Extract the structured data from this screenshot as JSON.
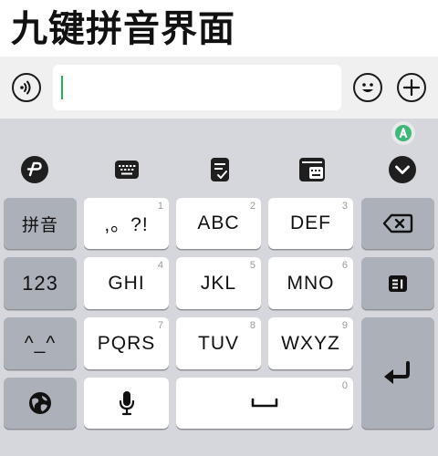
{
  "header": {
    "title": "九键拼音界面"
  },
  "input_bar": {
    "text": ""
  },
  "keys": {
    "pinyin": "拼音",
    "num_mode": "123",
    "emoticon": "^_^",
    "k1": {
      "label": ",。?!",
      "digit": "1"
    },
    "k2": {
      "label": "ABC",
      "digit": "2"
    },
    "k3": {
      "label": "DEF",
      "digit": "3"
    },
    "k4": {
      "label": "GHI",
      "digit": "4"
    },
    "k5": {
      "label": "JKL",
      "digit": "5"
    },
    "k6": {
      "label": "MNO",
      "digit": "6"
    },
    "k7": {
      "label": "PQRS",
      "digit": "7"
    },
    "k8": {
      "label": "TUV",
      "digit": "8"
    },
    "k9": {
      "label": "WXYZ",
      "digit": "9"
    },
    "k0": {
      "digit": "0"
    }
  },
  "icons": {
    "voice": "sound-wave-icon",
    "emoji": "smiley-icon",
    "add": "plus-icon",
    "badge": "assistant-badge-icon",
    "toolbar": [
      "swipe-logo-icon",
      "keyboard-icon",
      "clipboard-icon",
      "keyboard-switch-icon",
      "collapse-icon"
    ],
    "delete": "backspace-icon",
    "edit": "edit-panel-icon",
    "globe": "globe-icon",
    "mic": "microphone-icon",
    "space": "space-icon",
    "enter": "enter-icon"
  },
  "colors": {
    "caret": "#22b254",
    "badge": "#3cb879",
    "key_white": "#ffffff",
    "key_gray": "#acb0b9"
  }
}
